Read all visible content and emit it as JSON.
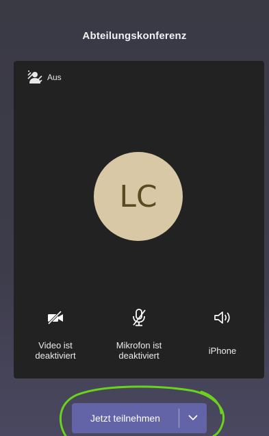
{
  "meeting": {
    "title": "Abteilungskonferenz"
  },
  "background": {
    "icon": "background-effects-icon",
    "label": "Aus"
  },
  "avatar": {
    "initials": "LC",
    "color": "#d8c8a6"
  },
  "controls": {
    "video_label": "Video ist\ndeaktiviert",
    "video_icon": "video-off-icon",
    "mic_label": "Mikrofon ist\ndeaktiviert",
    "mic_icon": "mic-off-icon",
    "audio_label": "iPhone",
    "audio_icon": "speaker-icon"
  },
  "join": {
    "label": "Jetzt teilnehmen",
    "accent": "#6264a7"
  },
  "annotation": {
    "color": "#6cd31c"
  }
}
